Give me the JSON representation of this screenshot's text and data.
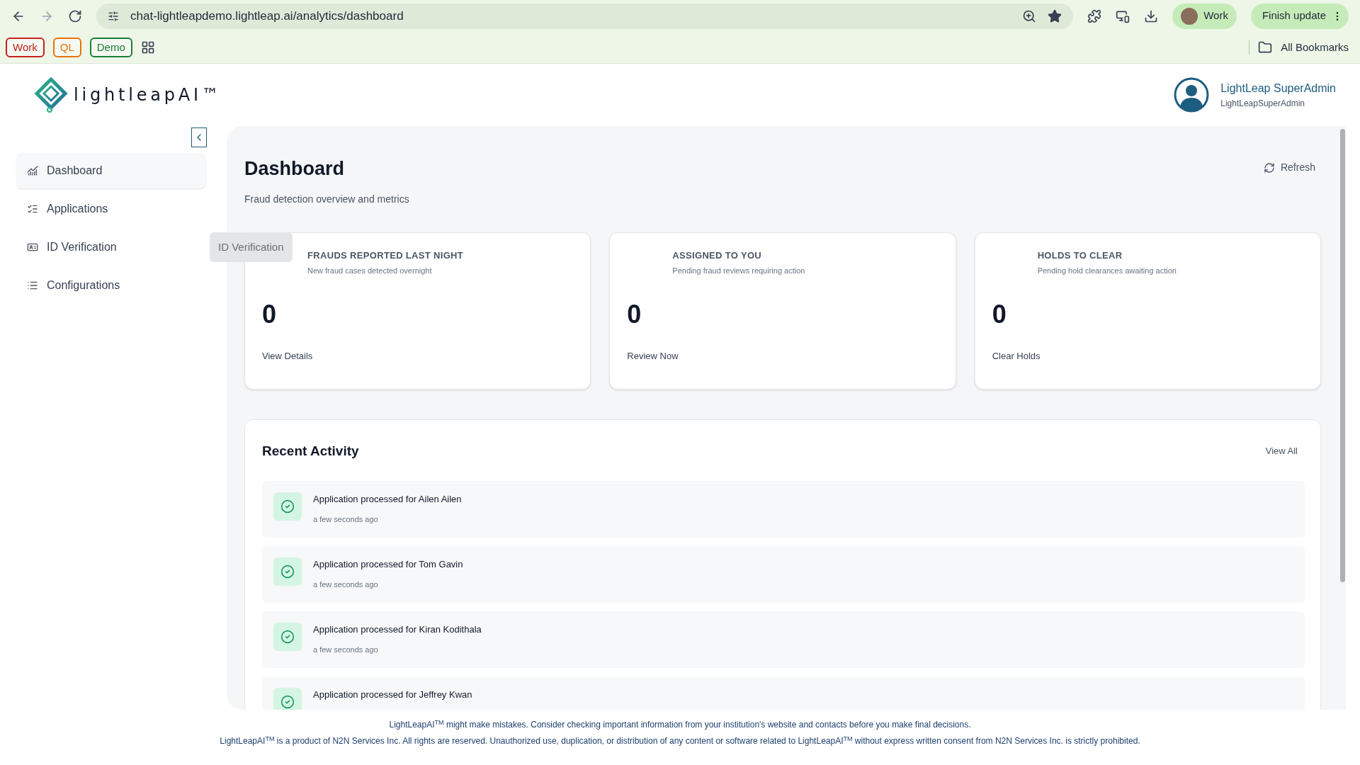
{
  "browser": {
    "url": "chat-lightleapdemo.lightleap.ai/analytics/dashboard",
    "profile": "Work",
    "update_button": "Finish update",
    "bookmarks": [
      {
        "label": "Work",
        "color": "#c5221f"
      },
      {
        "label": "QL",
        "color": "#e8710a"
      },
      {
        "label": "Demo",
        "color": "#188038"
      }
    ],
    "all_bookmarks": "All Bookmarks"
  },
  "logo": {
    "text": "lightleapAI",
    "mark": "™"
  },
  "user": {
    "name": "LightLeap SuperAdmin",
    "username": "LightLeapSuperAdmin"
  },
  "sidebar": {
    "items": [
      {
        "label": "Dashboard",
        "kind": "chart",
        "selected": true
      },
      {
        "label": "Applications",
        "kind": "checklist",
        "selected": false
      },
      {
        "label": "ID Verification",
        "kind": "idcard",
        "selected": false
      },
      {
        "label": "Configurations",
        "kind": "list",
        "selected": false
      }
    ],
    "tooltip": "ID Verification"
  },
  "page": {
    "title": "Dashboard",
    "subtitle": "Fraud detection overview and metrics",
    "refresh": "Refresh"
  },
  "cards": [
    {
      "title": "FRAUDS REPORTED LAST NIGHT",
      "description": "New fraud cases detected overnight",
      "value": "0",
      "action": "View Details"
    },
    {
      "title": "ASSIGNED TO YOU",
      "description": "Pending fraud reviews requiring action",
      "value": "0",
      "action": "Review Now"
    },
    {
      "title": "HOLDS TO CLEAR",
      "description": "Pending hold clearances awaiting action",
      "value": "0",
      "action": "Clear Holds"
    }
  ],
  "recent_activity": {
    "title": "Recent Activity",
    "view_all": "View All",
    "items": [
      {
        "text": "Application processed for Ailen Ailen",
        "time": "a few seconds ago"
      },
      {
        "text": "Application processed for Tom Gavin",
        "time": "a few seconds ago"
      },
      {
        "text": "Application processed for Kiran Kodithala",
        "time": "a few seconds ago"
      },
      {
        "text": "Application processed for Jeffrey Kwan"
      }
    ]
  },
  "footer": [
    "LightLeapAI$^{TM}$ might make mistakes. Consider checking important information from your institution's website and contacts before you make final decisions.",
    "LightLeapAI$^{TM}$ is a product of N2N Services Inc. All rights are reserved. Unauthorized use, duplication, or distribution of any content or software related to LightLeapAI$^{TM}$ without express written consent from N2N Services Inc. is strictly prohibited."
  ]
}
